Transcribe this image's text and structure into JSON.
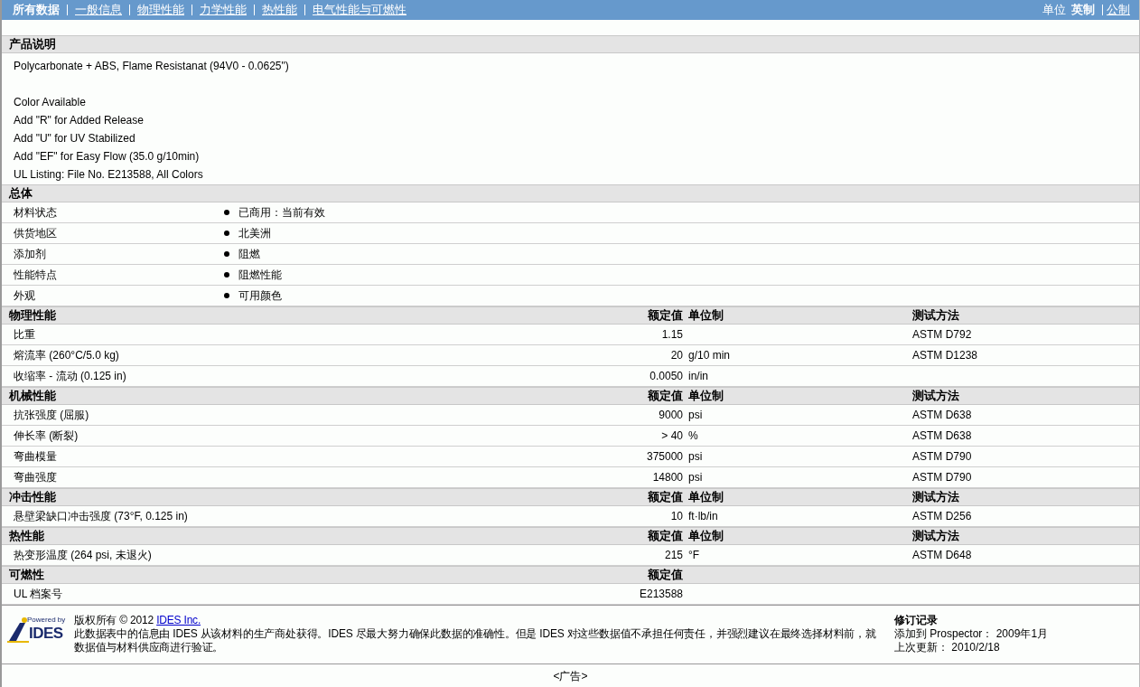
{
  "nav": {
    "tabs": [
      {
        "label": "所有数据",
        "selected": true
      },
      {
        "label": "一般信息",
        "selected": false
      },
      {
        "label": "物理性能",
        "selected": false
      },
      {
        "label": "力学性能",
        "selected": false
      },
      {
        "label": "热性能",
        "selected": false
      },
      {
        "label": "电气性能与可燃性",
        "selected": false
      }
    ],
    "units": {
      "label": "单位",
      "options": [
        {
          "label": "英制",
          "selected": true
        },
        {
          "label": "公制",
          "selected": false
        }
      ]
    }
  },
  "description": {
    "title": "产品说明",
    "paragraphs": [
      [
        "Polycarbonate + ABS, Flame Resistanat (94V0 - 0.0625\")"
      ],
      [
        "Color Available",
        "Add \"R\" for Added Release",
        "Add \"U\" for UV Stabilized",
        "Add \"EF\" for Easy Flow (35.0 g/10min)",
        "UL Listing: File No. E213588, All Colors"
      ]
    ]
  },
  "general": {
    "title": "总体",
    "rows": [
      {
        "label": "材料状态",
        "value": "已商用：当前有效"
      },
      {
        "label": "供货地区",
        "value": "北美洲"
      },
      {
        "label": "添加剂",
        "value": "阻燃"
      },
      {
        "label": "性能特点",
        "value": "阻燃性能"
      },
      {
        "label": "外观",
        "value": "可用颜色"
      }
    ]
  },
  "sections": [
    {
      "title": "物理性能",
      "columns": [
        "额定值",
        "单位制",
        "测试方法"
      ],
      "rows": [
        {
          "name": "比重",
          "value": "1.15",
          "method": "ASTM D792"
        },
        {
          "name": "熔流率  (260°C/5.0 kg)",
          "value": "20",
          "unit": "g/10 min",
          "method": "ASTM D1238"
        },
        {
          "name": "收缩率  - 流动  (0.125 in)",
          "value": "0.0050",
          "unit": "in/in"
        }
      ]
    },
    {
      "title": "机械性能",
      "columns": [
        "额定值",
        "单位制",
        "测试方法"
      ],
      "rows": [
        {
          "name": "抗张强度  (屈服)",
          "value": "9000",
          "unit": "psi",
          "method": "ASTM D638"
        },
        {
          "name": "伸长率  (断裂)",
          "value": "> 40",
          "unit": "%",
          "method": "ASTM D638"
        },
        {
          "name": "弯曲模量",
          "value": "375000",
          "unit": "psi",
          "method": "ASTM D790"
        },
        {
          "name": "弯曲强度",
          "value": "14800",
          "unit": "psi",
          "method": "ASTM D790"
        }
      ]
    },
    {
      "title": "冲击性能",
      "columns": [
        "额定值",
        "单位制",
        "测试方法"
      ],
      "rows": [
        {
          "name": "悬壁梁缺口冲击强度  (73°F, 0.125 in)",
          "value": "10",
          "unit": "ft·lb/in",
          "method": "ASTM D256"
        }
      ]
    },
    {
      "title": "热性能",
      "columns": [
        "额定值",
        "单位制",
        "测试方法"
      ],
      "rows": [
        {
          "name": "热变形温度  (264 psi, 未退火)",
          "value": "215",
          "unit": "°F",
          "method": "ASTM D648"
        }
      ]
    },
    {
      "title": "可燃性",
      "columns": [
        "额定值"
      ],
      "rows": [
        {
          "name": "UL 档案号",
          "value": "E213588"
        }
      ]
    }
  ],
  "footer": {
    "logo": {
      "caption": "Powered by",
      "name": "IDES"
    },
    "copyright": "版权所有  © 2012",
    "copyright_link": "IDES Inc.",
    "disclaimer": "此数据表中的信息由  IDES 从该材料的生产商处获得。IDES 尽最大努力确保此数据的准确性。但是  IDES 对这些数据值不承担任何责任，并强烈建议在最终选择材料前，就数据值与材料供应商进行验证。",
    "revision": {
      "title": "修订记录",
      "added": "添加到  Prospector：  2009年1月",
      "updated": "上次更新：  2010/2/18"
    }
  },
  "ad": "<广告>"
}
